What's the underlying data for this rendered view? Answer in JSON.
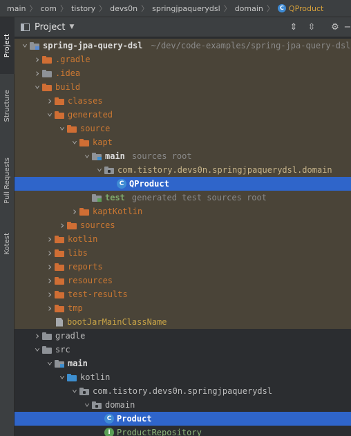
{
  "breadcrumb": {
    "items": [
      "main",
      "com",
      "tistory",
      "devs0n",
      "springjpaquerydsl",
      "domain"
    ],
    "current": "QProduct",
    "current_icon": "class-icon"
  },
  "side_tabs": [
    "Project",
    "Structure",
    "Pull Requests",
    "Kotest"
  ],
  "panel": {
    "title": "Project",
    "buttons": [
      "expand-all-icon",
      "collapse-all-icon",
      "settings-icon",
      "minimize-icon"
    ]
  },
  "tree": [
    {
      "depth": 0,
      "arrow": "down",
      "icon": "module",
      "label": "spring-jpa-query-dsl",
      "style": "bold",
      "path": "~/dev/code-examples/spring-jpa-query-dsl",
      "bg": "excluded"
    },
    {
      "depth": 1,
      "arrow": "right",
      "icon": "folder-orange",
      "label": ".gradle",
      "style": "orange",
      "bg": "excluded"
    },
    {
      "depth": 1,
      "arrow": "right",
      "icon": "folder-grey",
      "label": ".idea",
      "style": "orange",
      "bg": "excluded"
    },
    {
      "depth": 1,
      "arrow": "down",
      "icon": "folder-orange",
      "label": "build",
      "style": "orange",
      "bg": "excluded"
    },
    {
      "depth": 2,
      "arrow": "right",
      "icon": "folder-orange",
      "label": "classes",
      "style": "orange",
      "bg": "excluded"
    },
    {
      "depth": 2,
      "arrow": "down",
      "icon": "folder-orange",
      "label": "generated",
      "style": "orange",
      "bg": "excluded"
    },
    {
      "depth": 3,
      "arrow": "down",
      "icon": "folder-orange",
      "label": "source",
      "style": "orange",
      "bg": "excluded"
    },
    {
      "depth": 4,
      "arrow": "down",
      "icon": "folder-orange",
      "label": "kapt",
      "style": "orange",
      "bg": "excluded"
    },
    {
      "depth": 5,
      "arrow": "down",
      "icon": "folder-source",
      "label": "main",
      "style": "bold",
      "hint": "sources root",
      "bg": "excluded"
    },
    {
      "depth": 6,
      "arrow": "down",
      "icon": "package",
      "label": "com.tistory.devs0n.springjpaquerydsl.domain",
      "style": "pkg",
      "bg": "excluded"
    },
    {
      "depth": 7,
      "arrow": "",
      "icon": "class",
      "label": "QProduct",
      "style": "white",
      "bg": "selected"
    },
    {
      "depth": 5,
      "arrow": "",
      "icon": "folder-test",
      "label": "test",
      "style": "green",
      "hint": "generated test sources root",
      "bg": "excluded"
    },
    {
      "depth": 4,
      "arrow": "right",
      "icon": "folder-orange",
      "label": "kaptKotlin",
      "style": "orange",
      "bg": "excluded"
    },
    {
      "depth": 3,
      "arrow": "right",
      "icon": "folder-orange",
      "label": "sources",
      "style": "orange",
      "bg": "excluded"
    },
    {
      "depth": 2,
      "arrow": "right",
      "icon": "folder-orange",
      "label": "kotlin",
      "style": "orange",
      "bg": "excluded"
    },
    {
      "depth": 2,
      "arrow": "right",
      "icon": "folder-orange",
      "label": "libs",
      "style": "orange",
      "bg": "excluded"
    },
    {
      "depth": 2,
      "arrow": "right",
      "icon": "folder-orange",
      "label": "reports",
      "style": "orange",
      "bg": "excluded"
    },
    {
      "depth": 2,
      "arrow": "right",
      "icon": "folder-orange",
      "label": "resources",
      "style": "orange",
      "bg": "excluded"
    },
    {
      "depth": 2,
      "arrow": "right",
      "icon": "folder-orange",
      "label": "test-results",
      "style": "orange",
      "bg": "excluded"
    },
    {
      "depth": 2,
      "arrow": "right",
      "icon": "folder-orange",
      "label": "tmp",
      "style": "orange",
      "bg": "excluded"
    },
    {
      "depth": 2,
      "arrow": "",
      "icon": "file",
      "label": "bootJarMainClassName",
      "style": "gold",
      "bg": "excluded"
    },
    {
      "depth": 1,
      "arrow": "right",
      "icon": "folder-grey",
      "label": "gradle",
      "style": "default",
      "bg": ""
    },
    {
      "depth": 1,
      "arrow": "down",
      "icon": "folder-grey",
      "label": "src",
      "style": "default",
      "bg": ""
    },
    {
      "depth": 2,
      "arrow": "down",
      "icon": "folder-source",
      "label": "main",
      "style": "bold",
      "bg": ""
    },
    {
      "depth": 3,
      "arrow": "down",
      "icon": "folder-blue",
      "label": "kotlin",
      "style": "default",
      "bg": ""
    },
    {
      "depth": 4,
      "arrow": "down",
      "icon": "package",
      "label": "com.tistory.devs0n.springjpaquerydsl",
      "style": "default",
      "bg": ""
    },
    {
      "depth": 5,
      "arrow": "down",
      "icon": "package",
      "label": "domain",
      "style": "default",
      "bg": ""
    },
    {
      "depth": 6,
      "arrow": "",
      "icon": "class",
      "label": "Product",
      "style": "white",
      "bg": "selected"
    },
    {
      "depth": 6,
      "arrow": "",
      "icon": "interface",
      "label": "ProductRepository",
      "style": "green-plain",
      "bg": ""
    }
  ],
  "colors": {
    "background": "#2b2d30",
    "excluded_row": "#4a4438",
    "selection": "#2f65ca",
    "excluded_text": "#cc7832"
  }
}
